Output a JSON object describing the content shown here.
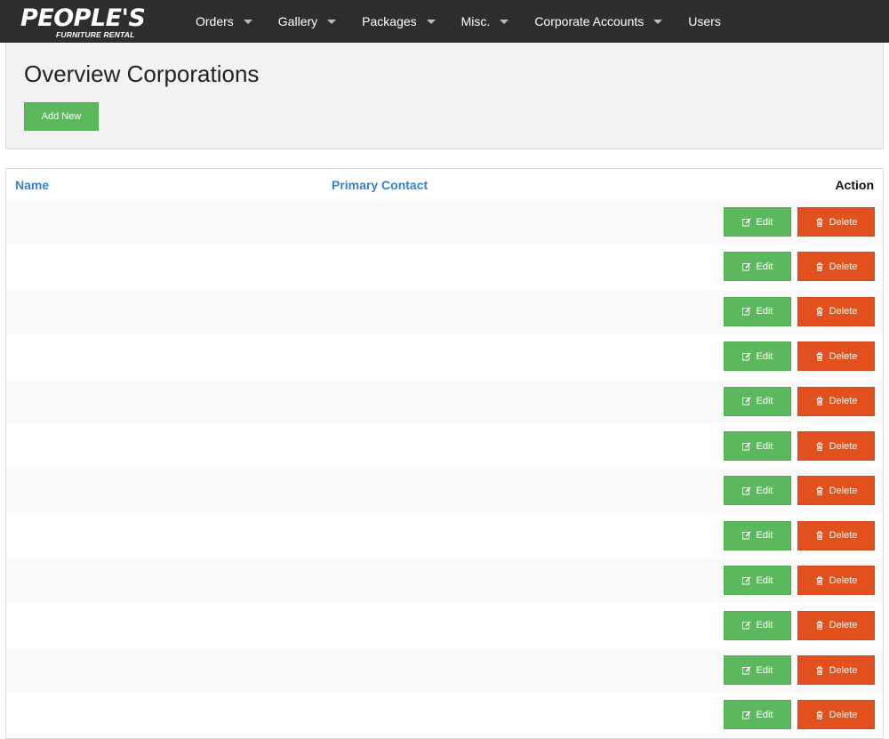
{
  "logo": {
    "main": "PEOPLE'S",
    "sub": "FURNITURE RENTAL"
  },
  "nav": [
    {
      "label": "Orders",
      "dropdown": true
    },
    {
      "label": "Gallery",
      "dropdown": true
    },
    {
      "label": "Packages",
      "dropdown": true
    },
    {
      "label": "Misc.",
      "dropdown": true
    },
    {
      "label": "Corporate Accounts",
      "dropdown": true
    },
    {
      "label": "Users",
      "dropdown": false
    }
  ],
  "header": {
    "title": "Overview Corporations",
    "add_label": "Add New"
  },
  "table": {
    "columns": {
      "name": "Name",
      "contact": "Primary Contact",
      "action": "Action"
    },
    "edit_label": "Edit",
    "delete_label": "Delete",
    "rows": [
      {
        "name": "",
        "contact": ""
      },
      {
        "name": "",
        "contact": ""
      },
      {
        "name": "",
        "contact": ""
      },
      {
        "name": "",
        "contact": ""
      },
      {
        "name": "",
        "contact": ""
      },
      {
        "name": "",
        "contact": ""
      },
      {
        "name": "",
        "contact": ""
      },
      {
        "name": "",
        "contact": ""
      },
      {
        "name": "",
        "contact": ""
      },
      {
        "name": "",
        "contact": ""
      },
      {
        "name": "",
        "contact": ""
      },
      {
        "name": "",
        "contact": ""
      }
    ]
  },
  "colors": {
    "navbar": "#2e2e2e",
    "link": "#3a82c4",
    "success": "#5cb85c",
    "danger": "#e2501d"
  }
}
